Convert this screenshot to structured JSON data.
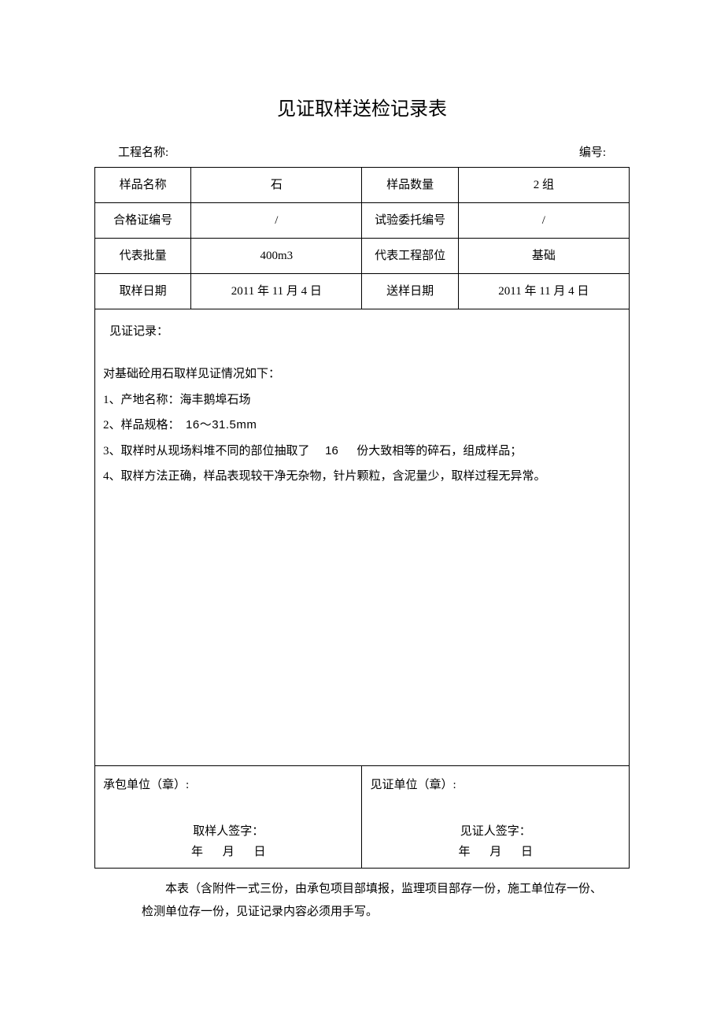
{
  "title": "见证取样送检记录表",
  "meta": {
    "project_label": "工程名称:",
    "serial_label": "编号:"
  },
  "grid": {
    "r1": {
      "k1": "样品名称",
      "v1": "石",
      "k2": "样品数量",
      "v2": "2 组"
    },
    "r2": {
      "k1": "合格证编号",
      "v1": "/",
      "k2": "试验委托编号",
      "v2": "/"
    },
    "r3": {
      "k1": "代表批量",
      "v1": "400m3",
      "k2": "代表工程部位",
      "v2": "基础"
    },
    "r4": {
      "k1": "取样日期",
      "v1": "2011 年 11 月 4 日",
      "k2": "送样日期",
      "v2": "2011 年 11 月 4 日"
    }
  },
  "record": {
    "label": "见证记录：",
    "intro": "对基础砼用石取样见证情况如下：",
    "line1": "1、产地名称：海丰鹅埠石场",
    "line2_pre": "2、样品规格：　",
    "line2_spec": "16～31.5mm",
    "line3_pre": "3、取样时从现场料堆不同的部位抽取了",
    "line3_num": "16",
    "line3_post": " 份大致相等的碎石，组成样品；",
    "line4": "4、取样方法正确，样品表现较干净无杂物，针片颗粒，含泥量少，取样过程无异常。"
  },
  "sign": {
    "left_unit": "承包单位（章）:",
    "left_sign": "取样人签字：",
    "right_unit": "见证单位（章）:",
    "right_sign": "见证人签字：",
    "y": "年",
    "m": "月",
    "d": "日"
  },
  "footer": "本表（含附件一式三份，由承包项目部填报，监理项目部存一份，施工单位存一份、检测单位存一份，见证记录内容必须用手写。"
}
